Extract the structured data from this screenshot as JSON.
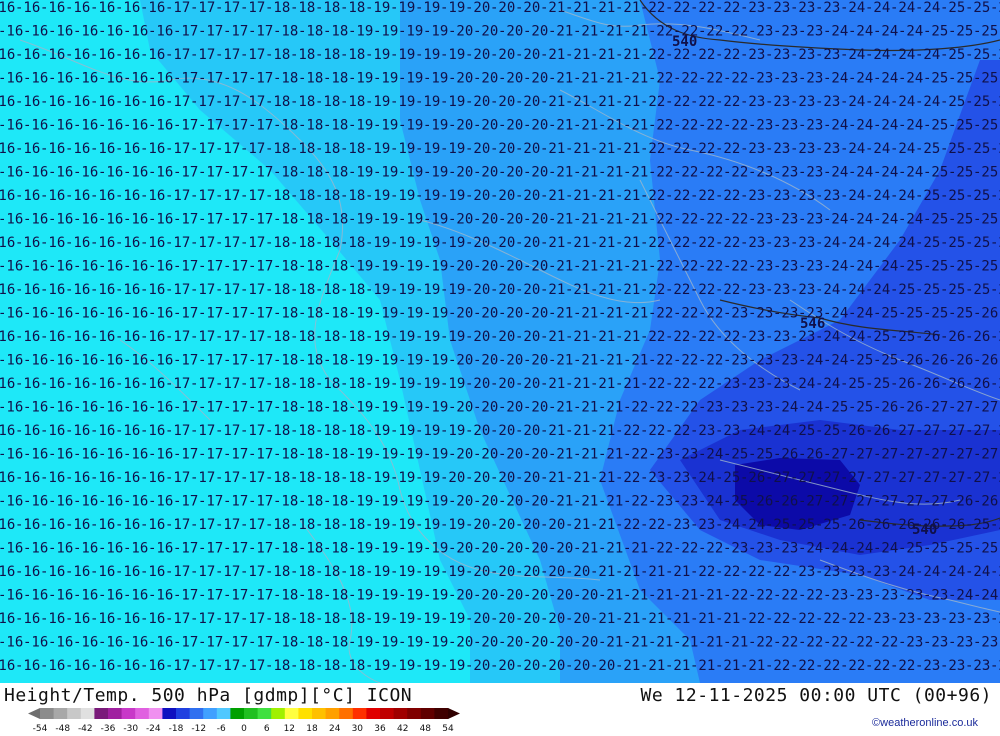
{
  "header": {
    "title": "Height/Temp. 500 hPa [gdmp][°C] ICON",
    "timestamp": "We 12-11-2025 00:00 UTC (00+96)",
    "copyright": "©weatheronline.co.uk"
  },
  "legend": {
    "ticks": [
      "-54",
      "-48",
      "-42",
      "-36",
      "-30",
      "-24",
      "-18",
      "-12",
      "-6",
      "0",
      "6",
      "12",
      "18",
      "24",
      "30",
      "36",
      "42",
      "48",
      "54"
    ],
    "colors": [
      "#8c8c8c",
      "#a8a8a8",
      "#c8c8c8",
      "#e0e0e0",
      "#7a1a7a",
      "#a020a0",
      "#c838c8",
      "#e060e0",
      "#f090f0",
      "#1010c0",
      "#2040e0",
      "#3070f0",
      "#40a0ff",
      "#50c8ff",
      "#00a000",
      "#20c020",
      "#40e040",
      "#a0f000",
      "#ffff40",
      "#ffe000",
      "#ffc000",
      "#ffa000",
      "#ff7000",
      "#ff3000",
      "#e00000",
      "#c00000",
      "#a00000",
      "#800000",
      "#600000",
      "#400000"
    ]
  },
  "map": {
    "contour_labels": [
      "540",
      "546",
      "540",
      "546"
    ],
    "temperature_values": [
      "-16",
      "-17",
      "-18",
      "-19",
      "-20",
      "-21",
      "-22",
      "-23",
      "-24",
      "-25",
      "-26",
      "-27"
    ]
  }
}
